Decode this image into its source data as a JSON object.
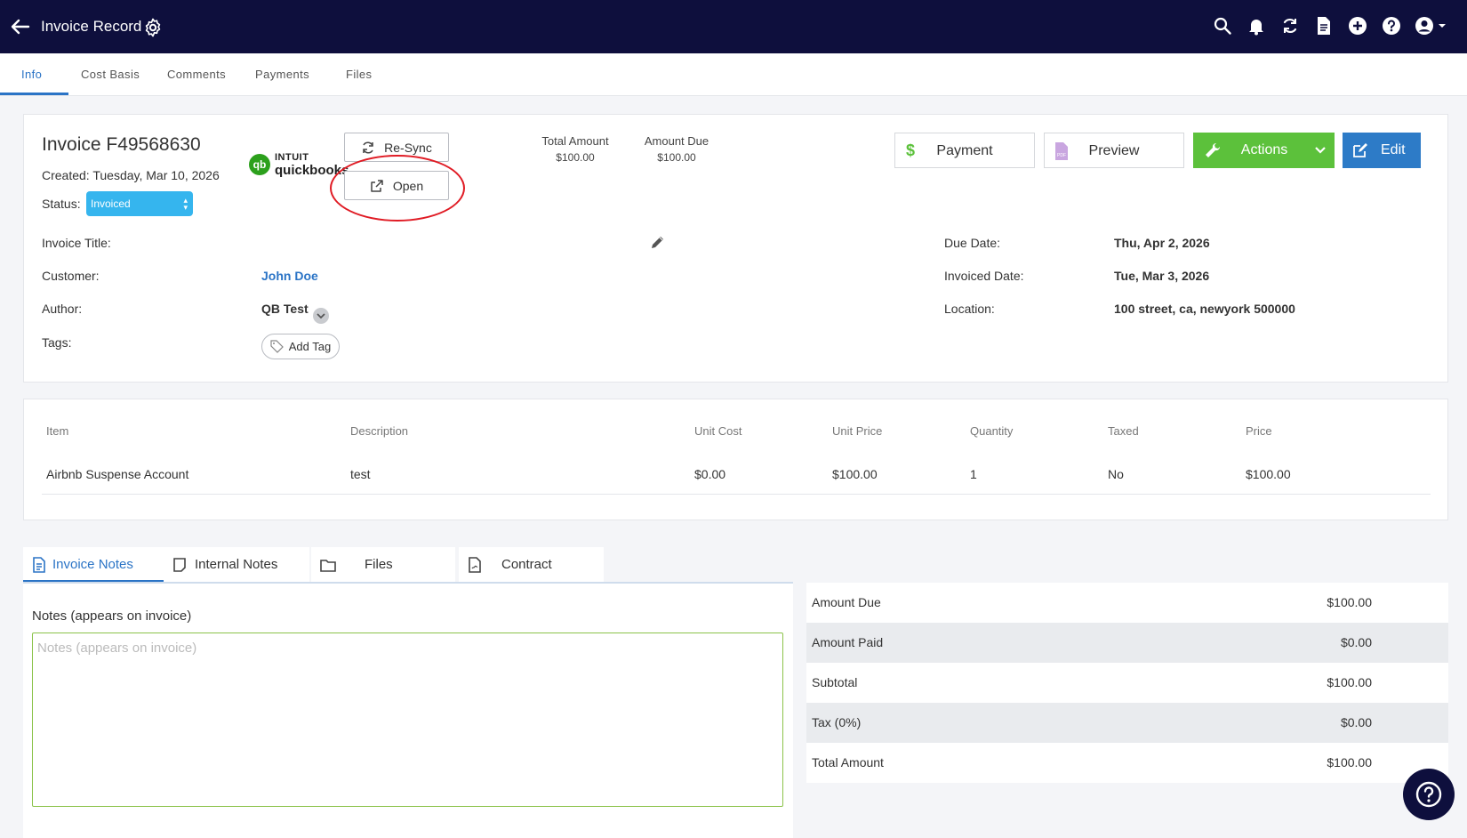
{
  "header": {
    "title": "Invoice Record"
  },
  "tabs": [
    {
      "label": "Info"
    },
    {
      "label": "Cost Basis"
    },
    {
      "label": "Comments"
    },
    {
      "label": "Payments"
    },
    {
      "label": "Files"
    }
  ],
  "invoice": {
    "number": "Invoice F49568630",
    "created": "Created: Tuesday, Mar 10, 2026",
    "status_label": "Status:",
    "status_value": "Invoiced",
    "qb_logo_line1": "INTUIT",
    "qb_logo_line2": "quickbooks",
    "resync_label": "Re-Sync",
    "open_label": "Open",
    "total_amount_label": "Total Amount",
    "total_amount_value": "$100.00",
    "amount_due_label": "Amount Due",
    "amount_due_value": "$100.00"
  },
  "toolbar": {
    "payment_label": "Payment",
    "preview_label": "Preview",
    "actions_label": "Actions",
    "edit_label": "Edit"
  },
  "fields": {
    "title_label": "Invoice Title:",
    "customer_label": "Customer:",
    "customer_value": "John Doe",
    "author_label": "Author:",
    "author_value": "QB Test",
    "tags_label": "Tags:",
    "add_tag_label": "Add Tag",
    "due_date_label": "Due Date:",
    "due_date_value": "Thu, Apr 2, 2026",
    "invoiced_date_label": "Invoiced Date:",
    "invoiced_date_value": "Tue, Mar 3, 2026",
    "location_label": "Location:",
    "location_value": "100 street, ca, newyork 500000"
  },
  "items_table": {
    "headers": [
      "Item",
      "Description",
      "Unit Cost",
      "Unit Price",
      "Quantity",
      "Taxed",
      "Price"
    ],
    "rows": [
      [
        "Airbnb Suspense Account",
        "test",
        "$0.00",
        "$100.00",
        "1",
        "No",
        "$100.00"
      ]
    ]
  },
  "notes_tabs": [
    {
      "label": "Invoice Notes"
    },
    {
      "label": "Internal Notes"
    },
    {
      "label": "Files"
    },
    {
      "label": "Contract"
    }
  ],
  "notes": {
    "title": "Notes (appears on invoice)",
    "placeholder": "Notes (appears on invoice)",
    "value": ""
  },
  "totals": [
    {
      "label": "Amount Due",
      "value": "$100.00"
    },
    {
      "label": "Amount Paid",
      "value": "$0.00"
    },
    {
      "label": "Subtotal",
      "value": "$100.00"
    },
    {
      "label": "Tax (0%)",
      "value": "$0.00"
    },
    {
      "label": "Total Amount",
      "value": "$100.00"
    }
  ],
  "colors": {
    "topbar": "#0e0f3d",
    "accent": "#2b74c6",
    "status": "#35b5ee",
    "actions": "#5cc13b",
    "edit": "#2d7bc7",
    "annotation": "#e01b24"
  }
}
